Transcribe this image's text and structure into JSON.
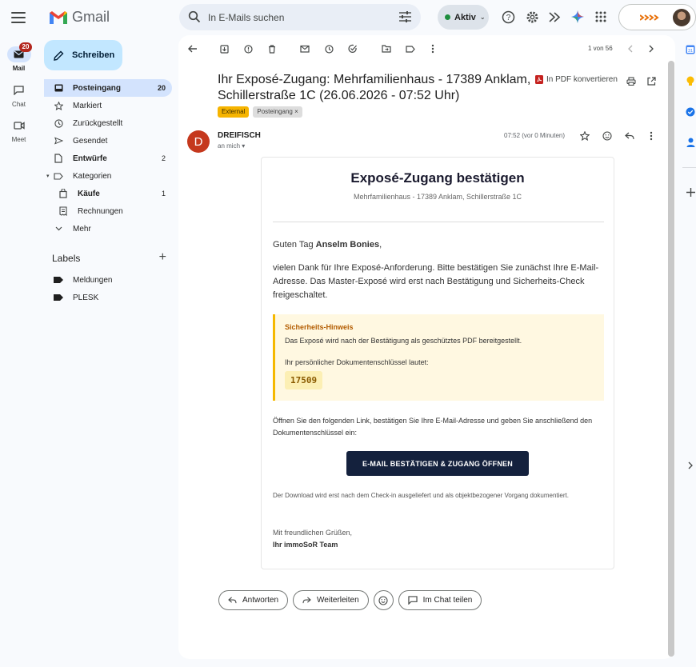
{
  "app": {
    "logo_text": "Gmail",
    "search_placeholder": "In E-Mails suchen",
    "status_label": "Aktiv",
    "accent": "#0b57d0",
    "status_color": "#1e8e3e"
  },
  "rail": {
    "items": [
      {
        "label": "Mail",
        "badge": "20",
        "icon": "mail-icon"
      },
      {
        "label": "Chat",
        "icon": "chat-icon"
      },
      {
        "label": "Meet",
        "icon": "video-icon"
      }
    ]
  },
  "nav": {
    "compose_label": "Schreiben",
    "items": [
      {
        "label": "Posteingang",
        "count": "20",
        "icon": "inbox-icon"
      },
      {
        "label": "Markiert",
        "icon": "star-icon"
      },
      {
        "label": "Zurückgestellt",
        "icon": "clock-icon"
      },
      {
        "label": "Gesendet",
        "icon": "send-icon"
      },
      {
        "label": "Entwürfe",
        "count": "2",
        "icon": "draft-icon"
      },
      {
        "label": "Kategorien",
        "icon": "label-icon"
      },
      {
        "label": "Käufe",
        "count": "1",
        "icon": "bag-icon"
      },
      {
        "label": "Rechnungen",
        "icon": "receipt-icon"
      },
      {
        "label": "Mehr",
        "icon": "chevron-down-icon"
      }
    ],
    "labels_heading": "Labels",
    "labels": [
      {
        "label": "Meldungen"
      },
      {
        "label": "PLESK"
      }
    ]
  },
  "toolbar": {
    "pager": "1 von 56"
  },
  "message": {
    "subject": "Ihr Exposé-Zugang: Mehrfamilienhaus - 17389 Anklam, Schillerstraße 1C (26.06.2026 - 07:52 Uhr)",
    "chip_external": "External",
    "chip_inbox": "Posteingang ×",
    "pdf_convert": "In PDF konvertieren",
    "sender_initial": "D",
    "sender_name": "DREIFISCH",
    "to_me": "an mich ▾",
    "time": "07:52 (vor 0 Minuten)"
  },
  "email": {
    "title": "Exposé-Zugang bestätigen",
    "address": "Mehrfamilienhaus - 17389 Anklam, Schillerstraße 1C",
    "greeting_prefix": "Guten Tag ",
    "greeting_name": "Anselm Bonies",
    "greeting_suffix": ",",
    "intro": "vielen Dank für Ihre Exposé-Anforderung. Bitte bestätigen Sie zunächst Ihre E-Mail-Adresse. Das Master-Exposé wird erst nach Bestätigung und Sicherheits-Check freigeschaltet.",
    "notice_title": "Sicherheits-Hinweis",
    "notice_text": "Das Exposé wird nach der Bestätigung als geschütztes PDF bereitgestellt.",
    "key_label": "Ihr persönlicher Dokumentenschlüssel lautet:",
    "key": "17509",
    "link_text": "Öffnen Sie den folgenden Link, bestätigen Sie Ihre E-Mail-Adresse und geben Sie anschließend den Dokumentenschlüssel ein:",
    "cta": "E-MAIL BESTÄTIGEN & ZUGANG ÖFFNEN",
    "download": "Der Download wird erst nach dem Check-in ausgeliefert und als objektbezogener Vorgang dokumentiert.",
    "regards": "Mit freundlichen Grüßen,",
    "team": "Ihr immoSoR Team"
  },
  "reply_bar": {
    "reply": "Antworten",
    "forward": "Weiterleiten",
    "chat_share": "Im Chat teilen"
  }
}
